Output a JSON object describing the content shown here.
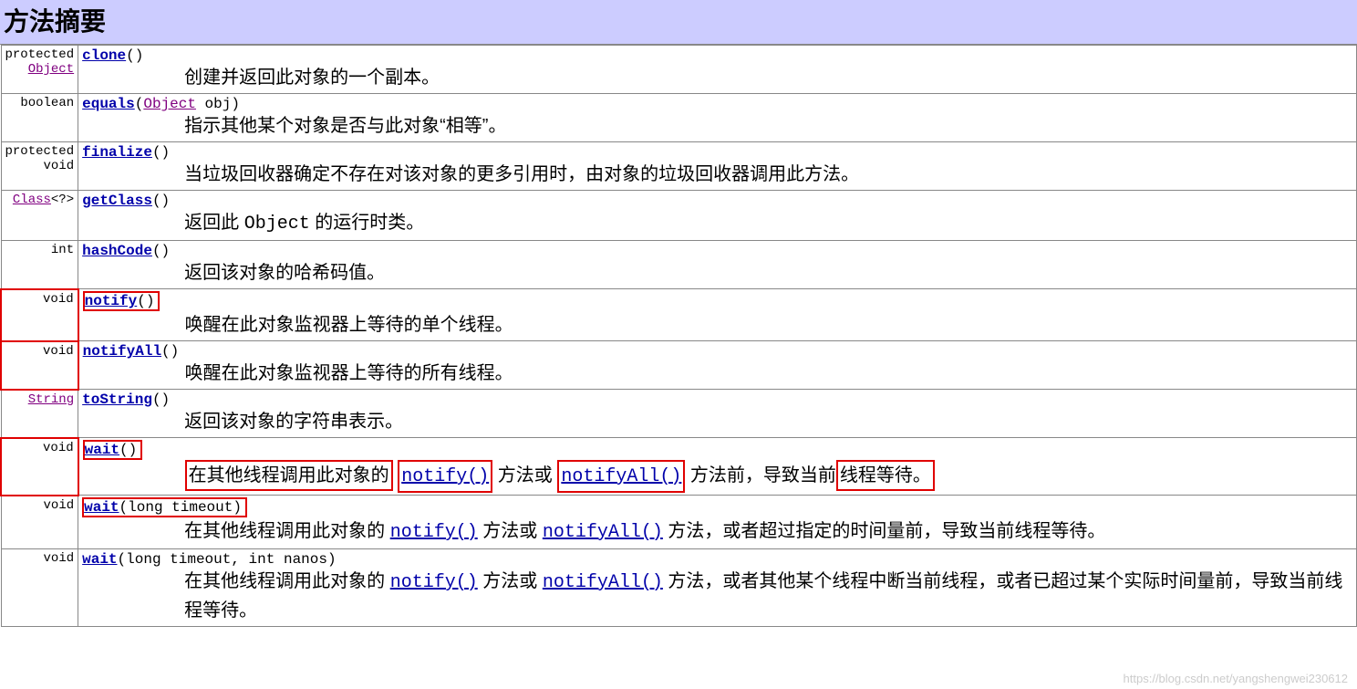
{
  "title": "方法摘要",
  "rows": [
    {
      "returnHtml": "protected <a href='#' class='visited'>Object</a>",
      "sigHtml": "<a href='#'><b>clone</b></a>()",
      "descHtml": "创建并返回此对象的一个副本。"
    },
    {
      "returnHtml": "boolean",
      "sigHtml": "<a href='#'><b>equals</b></a>(<a href='#' class='visited'>Object</a> obj)",
      "descHtml": "指示其他某个对象是否与此对象“相等”。"
    },
    {
      "returnHtml": "protected void",
      "sigHtml": "<a href='#'><b>finalize</b></a>()",
      "descHtml": "当垃圾回收器确定不存在对该对象的更多引用时，由对象的垃圾回收器调用此方法。"
    },
    {
      "returnHtml": "<a href='#' class='visited'>Class</a>&lt;?&gt;",
      "sigHtml": "<a href='#'><b>getClass</b></a>()",
      "descHtml": "返回此 <span class='mono'>Object</span> 的运行时类。"
    },
    {
      "returnHtml": "int",
      "sigHtml": "<a href='#'><b>hashCode</b></a>()",
      "descHtml": "返回该对象的哈希码值。"
    },
    {
      "returnHtml": "void",
      "retRed": true,
      "sigHtml": "<span class='redbox-sig'><a href='#'><b>notify</b></a>()</span>",
      "descHtml": "唤醒在此对象监视器上等待的单个线程。"
    },
    {
      "returnHtml": "void",
      "retRed": true,
      "sigHtml": "<a href='#'><b>notifyAll</b></a>()",
      "descHtml": "唤醒在此对象监视器上等待的所有线程。"
    },
    {
      "returnHtml": "<a href='#' class='visited'>String</a>",
      "sigHtml": "<a href='#'><b>toString</b></a>()",
      "descHtml": "返回该对象的字符串表示。"
    },
    {
      "returnHtml": "void",
      "retRed": true,
      "sigRedTight": true,
      "sigHtml": "<span class='redbox-sig'><a href='#'><b>wait</b></a>()</span>",
      "descHtml": "<span class='redbox'>在其他线程调用此对象的</span> <span class='redbox'><a href='#' class='mono'>notify()</a></span> 方法或 <span class='redbox'><a href='#' class='mono'>notifyAll()</a></span> 方法前，导致当前<span class='redbox'>线程等待。</span>"
    },
    {
      "returnHtml": "void",
      "sigHtml": "<span class='redbox-sig'><a href='#'><b>wait</b></a>(long timeout)</span>",
      "descHtml": "在其他线程调用此对象的 <a href='#' class='mono'>notify()</a> 方法或 <a href='#' class='mono'>notifyAll()</a> 方法，或者超过指定的时间量前，导致当前线程等待。"
    },
    {
      "returnHtml": "void",
      "sigHtml": "<a href='#'><b>wait</b></a>(long timeout, int nanos)",
      "descHtml": "在其他线程调用此对象的 <a href='#' class='mono'>notify()</a> 方法或 <a href='#' class='mono'>notifyAll()</a> 方法，或者其他某个线程中断当前线程，或者已超过某个实际时间量前，导致当前线程等待。"
    }
  ],
  "watermark": "https://blog.csdn.net/yangshengwei230612"
}
